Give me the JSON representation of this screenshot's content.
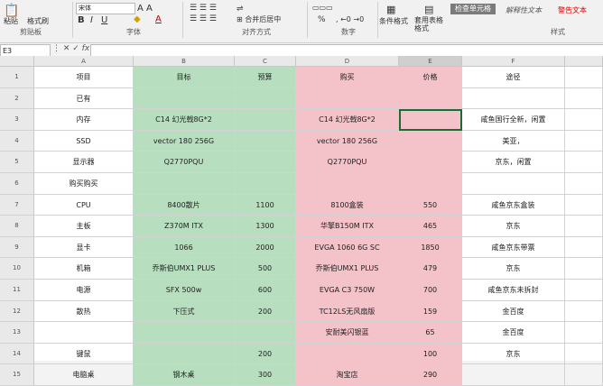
{
  "ribbon": {
    "paste": "粘贴",
    "format_painter": "格式刷",
    "font_name": "宋体",
    "merge_center": "合并后居中",
    "percent": "%",
    "conditional_format": "条件格式",
    "table_format": "套用表格格式",
    "check_cell": "检查单元格",
    "explanatory": "解释性文本",
    "warning": "警告文本",
    "groups": {
      "clipboard": "剪贴板",
      "font": "字体",
      "alignment": "对齐方式",
      "number": "数字",
      "styles": "样式"
    }
  },
  "namebox": "E3",
  "col_headers": [
    "A",
    "B",
    "C",
    "D",
    "E",
    "F"
  ],
  "header_row": {
    "a": "项目",
    "b": "目标",
    "c": "预算",
    "d": "购买",
    "e": "价格",
    "f": "途径"
  },
  "rows": [
    {
      "n": "2",
      "a": "已有",
      "b": "",
      "c": "",
      "d": "",
      "e": "",
      "f": ""
    },
    {
      "n": "3",
      "a": "内存",
      "b": "C14 幻光戟8G*2",
      "c": "",
      "d": "C14 幻光戟8G*2",
      "e": "",
      "f": "咸鱼国行全新，闲置"
    },
    {
      "n": "4",
      "a": "SSD",
      "b": "vector 180 256G",
      "c": "",
      "d": "vector 180 256G",
      "e": "",
      "f": "美亚，"
    },
    {
      "n": "5",
      "a": "显示器",
      "b": "Q2770PQU",
      "c": "",
      "d": "Q2770PQU",
      "e": "",
      "f": "京东，闲置"
    },
    {
      "n": "6",
      "a": "购买购买",
      "b": "",
      "c": "",
      "d": "",
      "e": "",
      "f": ""
    },
    {
      "n": "7",
      "a": "CPU",
      "b": "8400散片",
      "c": "1100",
      "d": "8100盒装",
      "e": "550",
      "f": "咸鱼京东盒装"
    },
    {
      "n": "8",
      "a": "主板",
      "b": "Z370M ITX",
      "c": "1300",
      "d": "华擎B150M ITX",
      "e": "465",
      "f": "京东"
    },
    {
      "n": "9",
      "a": "显卡",
      "b": "1066",
      "c": "2000",
      "d": "EVGA 1060 6G SC",
      "e": "1850",
      "f": "咸鱼京东带票"
    },
    {
      "n": "10",
      "a": "机箱",
      "b": "乔斯伯UMX1 PLUS",
      "c": "500",
      "d": "乔斯伯UMX1 PLUS",
      "e": "479",
      "f": "京东"
    },
    {
      "n": "11",
      "a": "电源",
      "b": "SFX 500w",
      "c": "600",
      "d": "EVGA C3 750W",
      "e": "700",
      "f": "咸鱼京东未拆封"
    },
    {
      "n": "12",
      "a": "散热",
      "b": "下压式",
      "c": "200",
      "d": "TC12LS无风扇版",
      "e": "159",
      "f": "金百度"
    },
    {
      "n": "13",
      "a": "",
      "b": "",
      "c": "",
      "d": "安耐美闪银蓝",
      "e": "65",
      "f": "金百度"
    },
    {
      "n": "14",
      "a": "键鼠",
      "b": "",
      "c": "200",
      "d": "",
      "e": "100",
      "f": "京东"
    },
    {
      "n": "15",
      "a": "电脑桌",
      "b": "钢木桌",
      "c": "300",
      "d": "淘宝店",
      "e": "290",
      "f": ""
    }
  ]
}
